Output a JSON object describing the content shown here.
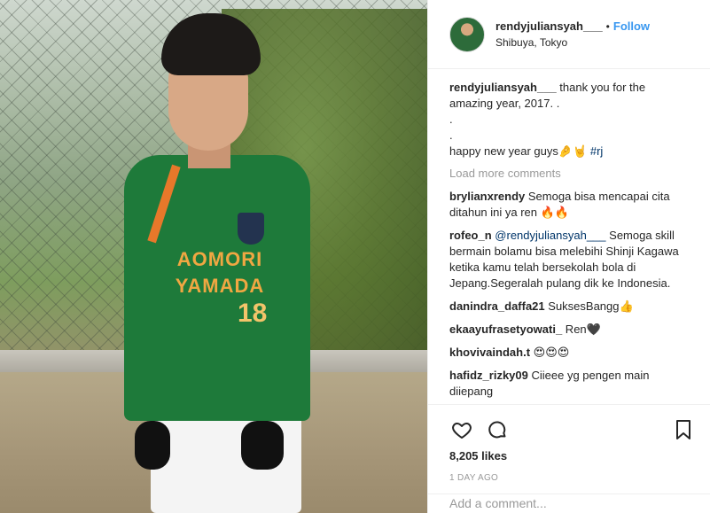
{
  "post": {
    "author": {
      "username": "rendyjuliansyah___",
      "location": "Shibuya, Tokyo",
      "follow_label": "Follow",
      "separator": "•"
    },
    "photo": {
      "sponsor_line1": "AOMORI",
      "sponsor_line2": "YAMADA",
      "shirt_number": "18"
    },
    "caption": {
      "username": "rendyjuliansyah___",
      "text": " thank you for the amazing year, 2017. .\n.\n.\nhappy new year guys🤌🤘 ",
      "hashtag": "#rj"
    },
    "load_more": "Load more comments",
    "comments": [
      {
        "username": "brylianxrendy",
        "text": " Semoga bisa mencapai cita ditahun ini ya ren 🔥🔥"
      },
      {
        "username": "rofeo_n",
        "mention": "@rendyjuliansyah___",
        "text": " Semoga skill bermain bolamu bisa melebihi Shinji Kagawa ketika kamu telah bersekolah bola di Jepang.Segeralah pulang dik ke Indonesia."
      },
      {
        "username": "danindra_daffa21",
        "text": " SuksesBangg👍"
      },
      {
        "username": "ekaayufrasetyowati_",
        "text": " Ren🖤"
      },
      {
        "username": "khovivaindah.t",
        "text": " 😍😍😍"
      },
      {
        "username": "hafidz_rizky09",
        "text": " Ciieee yg pengen main diiepang"
      }
    ],
    "likes": "8,205 likes",
    "time": "1 DAY AGO",
    "add_comment_placeholder": "Add a comment...",
    "icons": [
      "heart-icon",
      "comment-icon",
      "bookmark-icon"
    ]
  }
}
